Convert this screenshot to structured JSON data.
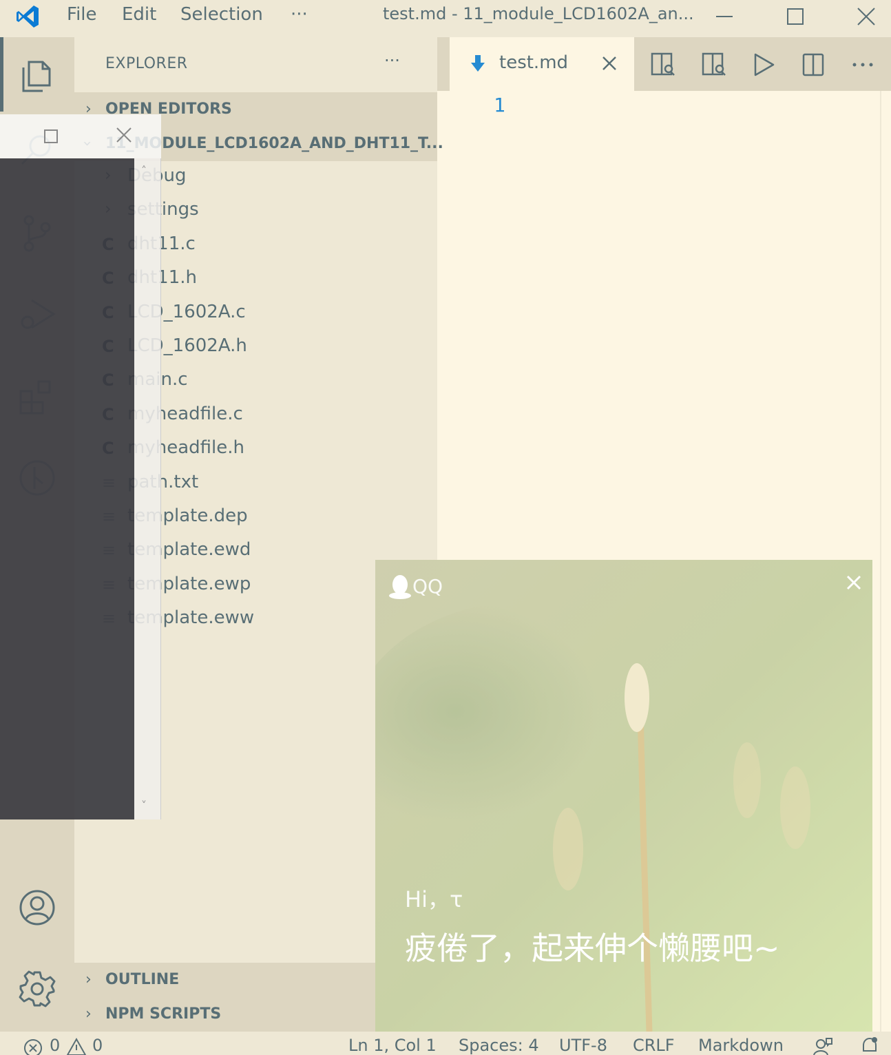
{
  "titlebar": {
    "menu": [
      "File",
      "Edit",
      "Selection",
      "···"
    ],
    "title": "test.md - 11_module_LCD1602A_an...",
    "logo_icon": "vscode-logo"
  },
  "activitybar": {
    "icons": [
      "explorer-icon",
      "search-icon",
      "source-control-icon",
      "run-debug-icon",
      "extensions-icon",
      "git-graph-icon",
      "account-icon",
      "settings-gear-icon"
    ]
  },
  "sidebar": {
    "title": "EXPLORER",
    "more": "···",
    "open_editors": "OPEN EDITORS",
    "folder": "11_MODULE_LCD1602A_AND_DHT11_T...",
    "items": [
      {
        "kind": "folder",
        "icon": "›",
        "name": "Debug"
      },
      {
        "kind": "folder",
        "icon": "›",
        "name": "settings"
      },
      {
        "kind": "c",
        "icon": "C",
        "name": "dht11.c"
      },
      {
        "kind": "c",
        "icon": "C",
        "name": "dht11.h"
      },
      {
        "kind": "c",
        "icon": "C",
        "name": "LCD_1602A.c"
      },
      {
        "kind": "c",
        "icon": "C",
        "name": "LCD_1602A.h"
      },
      {
        "kind": "c",
        "icon": "C",
        "name": "main.c"
      },
      {
        "kind": "c",
        "icon": "C",
        "name": "myheadfile.c"
      },
      {
        "kind": "c",
        "icon": "C",
        "name": "myheadfile.h"
      },
      {
        "kind": "txt",
        "icon": "≡",
        "name": "path.txt"
      },
      {
        "kind": "txt",
        "icon": "≡",
        "name": "template.dep"
      },
      {
        "kind": "txt",
        "icon": "≡",
        "name": "template.ewd"
      },
      {
        "kind": "txt",
        "icon": "≡",
        "name": "template.ewp"
      },
      {
        "kind": "txt",
        "icon": "≡",
        "name": "template.eww"
      }
    ],
    "outline": "OUTLINE",
    "npm_scripts": "NPM SCRIPTS",
    "chevron": "›"
  },
  "editor": {
    "tab_label": "test.md",
    "line_number": "1"
  },
  "statusbar": {
    "errors": "0",
    "warnings": "0",
    "position": "Ln 1, Col 1",
    "spaces": "Spaces: 4",
    "encoding": "UTF-8",
    "eol": "CRLF",
    "language": "Markdown"
  },
  "qq_popup": {
    "app_name": "QQ",
    "greeting": "Hi，τ",
    "message": "疲倦了，起来伸个懒腰吧~"
  },
  "colors": {
    "accent": "#268bd2",
    "sidebar_bg": "#eee8d5",
    "editor_bg": "#fdf6e3",
    "activity_bg": "#ddd6c1"
  }
}
